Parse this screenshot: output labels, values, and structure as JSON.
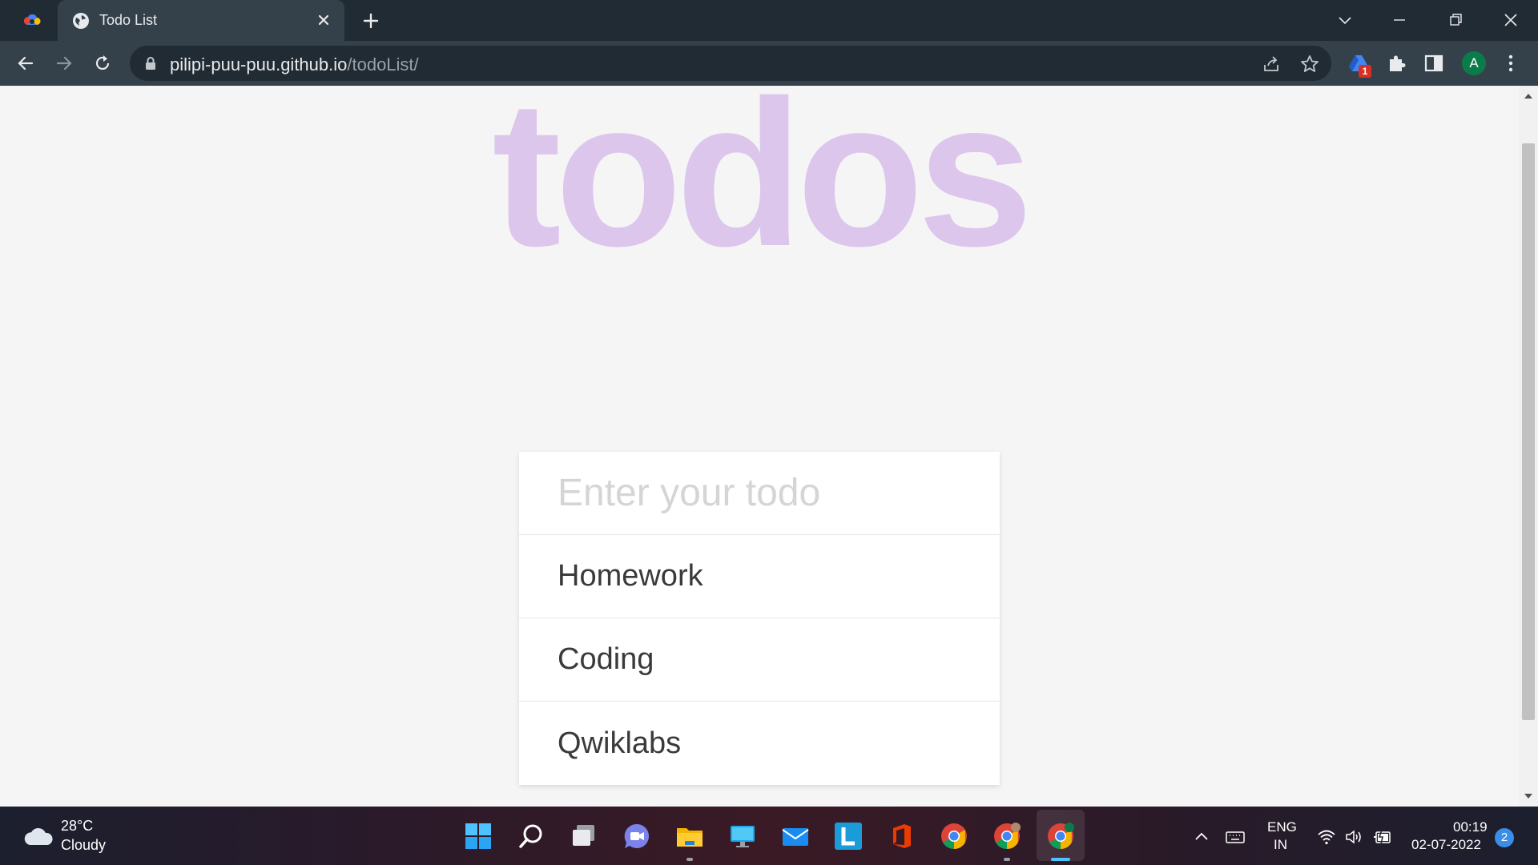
{
  "browser": {
    "tab_title": "Todo List",
    "url_domain": "pilipi-puu-puu.github.io",
    "url_path": "/todoList/",
    "extension_badge": "1",
    "profile_initial": "A"
  },
  "page": {
    "heading": "todos",
    "input_placeholder": "Enter your todo",
    "todos": [
      {
        "text": "Homework"
      },
      {
        "text": "Coding"
      },
      {
        "text": "Qwiklabs"
      }
    ]
  },
  "taskbar": {
    "weather_temp": "28°C",
    "weather_desc": "Cloudy",
    "lang_line1": "ENG",
    "lang_line2": "IN",
    "time": "00:19",
    "date": "02-07-2022",
    "notification_count": "2"
  },
  "colors": {
    "heading": "#dcc6ec",
    "chrome_dark": "#202b33",
    "chrome_toolbar": "#35414a",
    "page_background": "#f5f5f5"
  }
}
